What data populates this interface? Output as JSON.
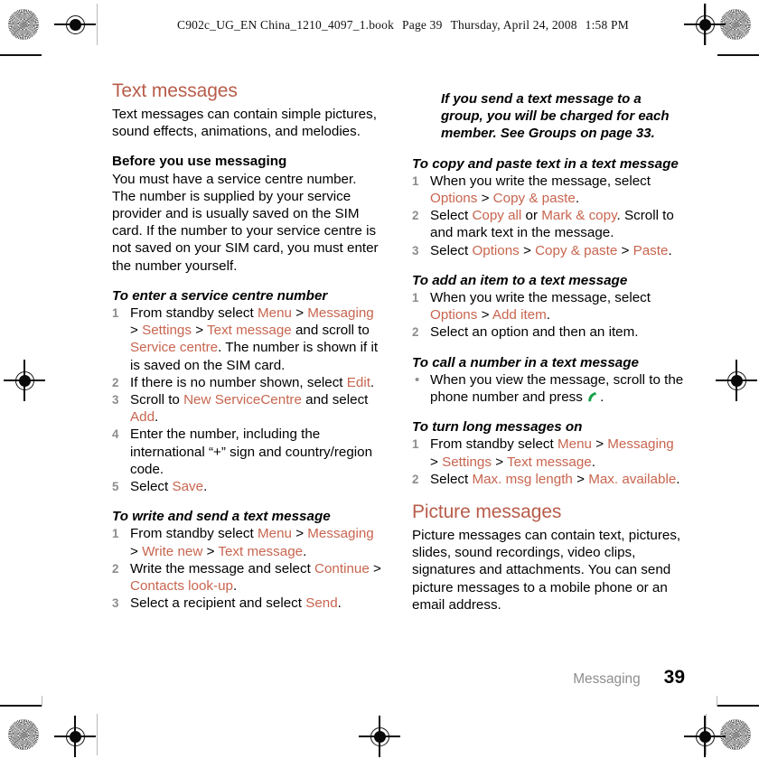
{
  "header": {
    "file_name": "C902c_UG_EN China_1210_4097_1.book",
    "page_label": "Page 39",
    "day": "Thursday,",
    "date": "April 24, 2008",
    "time": "1:58 PM"
  },
  "left_column": {
    "section_title": "Text messages",
    "intro": "Text messages can contain simple pictures, sound effects, animations, and melodies.",
    "subheading": "Before you use messaging",
    "subheading_body": "You must have a service centre number. The number is supplied by your service provider and is usually saved on the SIM card. If the number to your service centre is not saved on your SIM card, you must enter the number yourself.",
    "proc1": {
      "title": "To enter a service centre number",
      "steps": [
        {
          "num": "1",
          "parts": [
            {
              "t": "From standby select ",
              "ui": false
            },
            {
              "t": "Menu",
              "ui": true
            },
            {
              "t": " > ",
              "ui": false
            },
            {
              "t": "Messaging",
              "ui": true
            },
            {
              "t": " > ",
              "ui": false
            },
            {
              "t": "Settings",
              "ui": true
            },
            {
              "t": " > ",
              "ui": false
            },
            {
              "t": "Text message",
              "ui": true
            },
            {
              "t": " and scroll to ",
              "ui": false
            },
            {
              "t": "Service centre",
              "ui": true
            },
            {
              "t": ". The number is shown if it is saved on the SIM card.",
              "ui": false
            }
          ]
        },
        {
          "num": "2",
          "parts": [
            {
              "t": "If there is no number shown, select ",
              "ui": false
            },
            {
              "t": "Edit",
              "ui": true
            },
            {
              "t": ".",
              "ui": false
            }
          ]
        },
        {
          "num": "3",
          "parts": [
            {
              "t": "Scroll to ",
              "ui": false
            },
            {
              "t": "New ServiceCentre",
              "ui": true
            },
            {
              "t": " and select ",
              "ui": false
            },
            {
              "t": "Add",
              "ui": true
            },
            {
              "t": ".",
              "ui": false
            }
          ]
        },
        {
          "num": "4",
          "parts": [
            {
              "t": "Enter the number, including the international “+” sign and country/region code.",
              "ui": false
            }
          ]
        },
        {
          "num": "5",
          "parts": [
            {
              "t": "Select ",
              "ui": false
            },
            {
              "t": "Save",
              "ui": true
            },
            {
              "t": ".",
              "ui": false
            }
          ]
        }
      ]
    },
    "proc2": {
      "title": "To write and send a text message",
      "steps": [
        {
          "num": "1",
          "parts": [
            {
              "t": "From standby select ",
              "ui": false
            },
            {
              "t": "Menu",
              "ui": true
            },
            {
              "t": " > ",
              "ui": false
            },
            {
              "t": "Messaging",
              "ui": true
            },
            {
              "t": " > ",
              "ui": false
            },
            {
              "t": "Write new",
              "ui": true
            },
            {
              "t": " > ",
              "ui": false
            },
            {
              "t": "Text message",
              "ui": true
            },
            {
              "t": ".",
              "ui": false
            }
          ]
        },
        {
          "num": "2",
          "parts": [
            {
              "t": "Write the message and select ",
              "ui": false
            },
            {
              "t": "Continue",
              "ui": true
            },
            {
              "t": " > ",
              "ui": false
            },
            {
              "t": "Contacts look-up",
              "ui": true
            },
            {
              "t": ".",
              "ui": false
            }
          ]
        },
        {
          "num": "3",
          "parts": [
            {
              "t": "Select a recipient and select ",
              "ui": false
            },
            {
              "t": "Send",
              "ui": true
            },
            {
              "t": ".",
              "ui": false
            }
          ]
        }
      ]
    }
  },
  "right_column": {
    "note": "If you send a text message to a group, you will be charged for each member. See Groups on page 33.",
    "note_icon": "exclamation-icon",
    "proc3": {
      "title": "To copy and paste text in a text message",
      "steps": [
        {
          "num": "1",
          "parts": [
            {
              "t": "When you write the message, select ",
              "ui": false
            },
            {
              "t": "Options",
              "ui": true
            },
            {
              "t": " > ",
              "ui": false
            },
            {
              "t": "Copy & paste",
              "ui": true
            },
            {
              "t": ".",
              "ui": false
            }
          ]
        },
        {
          "num": "2",
          "parts": [
            {
              "t": "Select ",
              "ui": false
            },
            {
              "t": "Copy all",
              "ui": true
            },
            {
              "t": " or ",
              "ui": false
            },
            {
              "t": "Mark & copy",
              "ui": true
            },
            {
              "t": ". Scroll to and mark text in the message.",
              "ui": false
            }
          ]
        },
        {
          "num": "3",
          "parts": [
            {
              "t": "Select ",
              "ui": false
            },
            {
              "t": "Options",
              "ui": true
            },
            {
              "t": " > ",
              "ui": false
            },
            {
              "t": "Copy & paste",
              "ui": true
            },
            {
              "t": " > ",
              "ui": false
            },
            {
              "t": "Paste",
              "ui": true
            },
            {
              "t": ".",
              "ui": false
            }
          ]
        }
      ]
    },
    "proc4": {
      "title": "To add an item to a text message",
      "steps": [
        {
          "num": "1",
          "parts": [
            {
              "t": "When you write the message, select ",
              "ui": false
            },
            {
              "t": "Options",
              "ui": true
            },
            {
              "t": " > ",
              "ui": false
            },
            {
              "t": "Add item",
              "ui": true
            },
            {
              "t": ".",
              "ui": false
            }
          ]
        },
        {
          "num": "2",
          "parts": [
            {
              "t": "Select an option and then an item.",
              "ui": false
            }
          ]
        }
      ]
    },
    "proc5": {
      "title": "To call a number in a text message",
      "bullet": "•",
      "bullet_text_before": "When you view the message, scroll to the phone number and press ",
      "bullet_icon": "green-call-icon",
      "bullet_text_after": ".",
      "call_icon_color": "#17a04a"
    },
    "proc6": {
      "title": "To turn long messages on",
      "steps": [
        {
          "num": "1",
          "parts": [
            {
              "t": "From standby select ",
              "ui": false
            },
            {
              "t": "Menu",
              "ui": true
            },
            {
              "t": " > ",
              "ui": false
            },
            {
              "t": "Messaging",
              "ui": true
            },
            {
              "t": " > ",
              "ui": false
            },
            {
              "t": "Settings",
              "ui": true
            },
            {
              "t": " > ",
              "ui": false
            },
            {
              "t": "Text message",
              "ui": true
            },
            {
              "t": ".",
              "ui": false
            }
          ]
        },
        {
          "num": "2",
          "parts": [
            {
              "t": "Select ",
              "ui": false
            },
            {
              "t": "Max. msg length",
              "ui": true
            },
            {
              "t": " > ",
              "ui": false
            },
            {
              "t": "Max. available",
              "ui": true
            },
            {
              "t": ".",
              "ui": false
            }
          ]
        }
      ]
    },
    "section_title": "Picture messages",
    "section_body": "Picture messages can contain text, pictures, slides, sound recordings, video clips, signatures and attachments. You can send picture messages to a mobile phone or an email address."
  },
  "footer": {
    "section": "Messaging",
    "page_number": "39"
  },
  "colors": {
    "heading": "#b85c4a",
    "ui_term": "#c8654f",
    "call_icon": "#17a04a",
    "list_number": "#8d8d8d",
    "footer_section": "#8d8d8d"
  }
}
